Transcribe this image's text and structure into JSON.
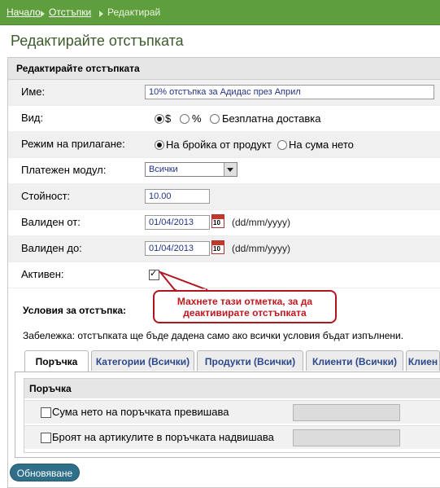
{
  "breadcrumb": {
    "home": "Начало",
    "discounts": "Отстъпки",
    "current": "Редактирай"
  },
  "page_title": "Редактирайте отстъпката",
  "panel_title": "Редактирайте отстъпката",
  "form": {
    "name_label": "Име:",
    "name_value": "10% отстъпка за Адидас през Април",
    "type_label": "Вид:",
    "type_options": [
      "$",
      "%",
      "Безплатна доставка"
    ],
    "type_selected": "$",
    "mode_label": "Режим на прилагане:",
    "mode_options": [
      "На бройка от продукт",
      "На сума нето"
    ],
    "mode_selected": "На бройка от продукт",
    "payment_label": "Платежен модул:",
    "payment_value": "Всички",
    "amount_label": "Стойност:",
    "amount_value": "10.00",
    "valid_from_label": "Валиден от:",
    "valid_from_value": "01/04/2013",
    "valid_to_label": "Валиден до:",
    "valid_to_value": "01/04/2013",
    "date_format": "(dd/mm/yyyy)",
    "calendar_day": "10",
    "active_label": "Активен:",
    "active_checked": true
  },
  "callout": {
    "line1": "Махнете тази отметка, за да",
    "line2": "деактивирате отстъпката"
  },
  "conditions": {
    "title": "Условия за отстъпка:",
    "note": "Забележка: отстъпката ще бъде дадена само ако всички условия бъдат изпълнени.",
    "tabs": [
      "Поръчка",
      "Категории (Всички)",
      "Продукти (Всички)",
      "Клиенти (Всички)",
      "Клиен"
    ],
    "active_tab": "Поръчка",
    "section_title": "Поръчка",
    "rows": [
      {
        "label": "Сума нето на поръчката превишава",
        "checked": false
      },
      {
        "label": "Броят на артикулите в поръчката надвишава",
        "checked": false
      }
    ]
  },
  "update_button": "Обновяване",
  "colors": {
    "breadcrumb_bg": "#5e9e3c",
    "callout_border": "#b0151f",
    "button_bg": "#2f6f8a"
  }
}
